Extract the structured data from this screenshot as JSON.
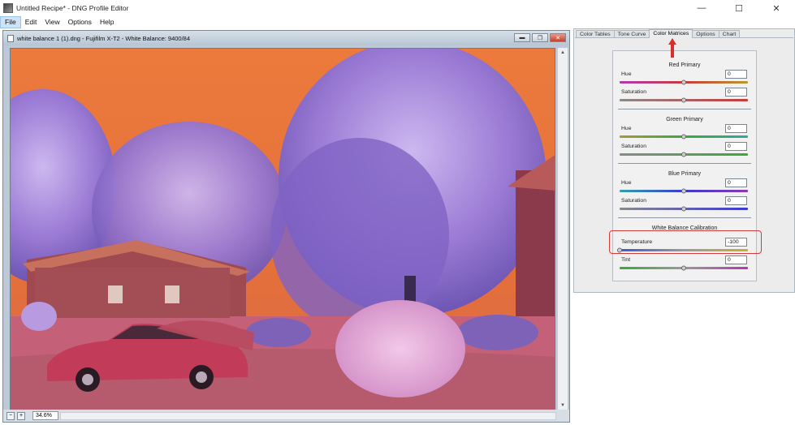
{
  "window": {
    "title": "Untitled Recipe* - DNG Profile Editor",
    "minimize_glyph": "—",
    "maximize_glyph": "☐",
    "close_glyph": "✕"
  },
  "menu": {
    "items": [
      "File",
      "Edit",
      "View",
      "Options",
      "Help"
    ]
  },
  "document": {
    "title": "white balance 1 (1).dng - Fujifilm X-T2 - White Balance: 9400/84",
    "zoom": "34.6%",
    "zoom_out_glyph": "−",
    "zoom_in_glyph": "+"
  },
  "panel": {
    "tabs": [
      "Color Tables",
      "Tone Curve",
      "Color Matrices",
      "Options",
      "Chart"
    ],
    "active_tab": "Color Matrices",
    "sections": [
      {
        "title": "Red Primary",
        "rows": [
          {
            "label": "Hue",
            "value": "0",
            "level": 0.5,
            "gradient": [
              "#b03ab0",
              "#c83a3a",
              "#b89a30"
            ]
          },
          {
            "label": "Saturation",
            "value": "0",
            "level": 0.5,
            "gradient": [
              "#8a8a8a",
              "#c83a3a"
            ]
          }
        ]
      },
      {
        "title": "Green Primary",
        "rows": [
          {
            "label": "Hue",
            "value": "0",
            "level": 0.5,
            "gradient": [
              "#a89a30",
              "#3aa83a",
              "#30a8a0"
            ]
          },
          {
            "label": "Saturation",
            "value": "0",
            "level": 0.5,
            "gradient": [
              "#8a8a8a",
              "#3aa83a"
            ]
          }
        ]
      },
      {
        "title": "Blue Primary",
        "rows": [
          {
            "label": "Hue",
            "value": "0",
            "level": 0.5,
            "gradient": [
              "#30a0b0",
              "#3a3ad0",
              "#8a3ab0"
            ]
          },
          {
            "label": "Saturation",
            "value": "0",
            "level": 0.5,
            "gradient": [
              "#8a8a8a",
              "#3a3ad0"
            ]
          }
        ]
      },
      {
        "title": "White Balance Calibration",
        "rows": [
          {
            "label": "Temperature",
            "value": "-100",
            "level": 0.0,
            "gradient": [
              "#3a5ad0",
              "#9a9a9a",
              "#c8b030"
            ]
          },
          {
            "label": "Tint",
            "value": "0",
            "level": 0.5,
            "gradient": [
              "#3aa83a",
              "#9a9a9a",
              "#b03ab0"
            ]
          }
        ]
      }
    ]
  },
  "colors": {
    "highlight": "#d63939",
    "photo_sky": "#e57438",
    "photo_foliage": "#a88ad8"
  }
}
